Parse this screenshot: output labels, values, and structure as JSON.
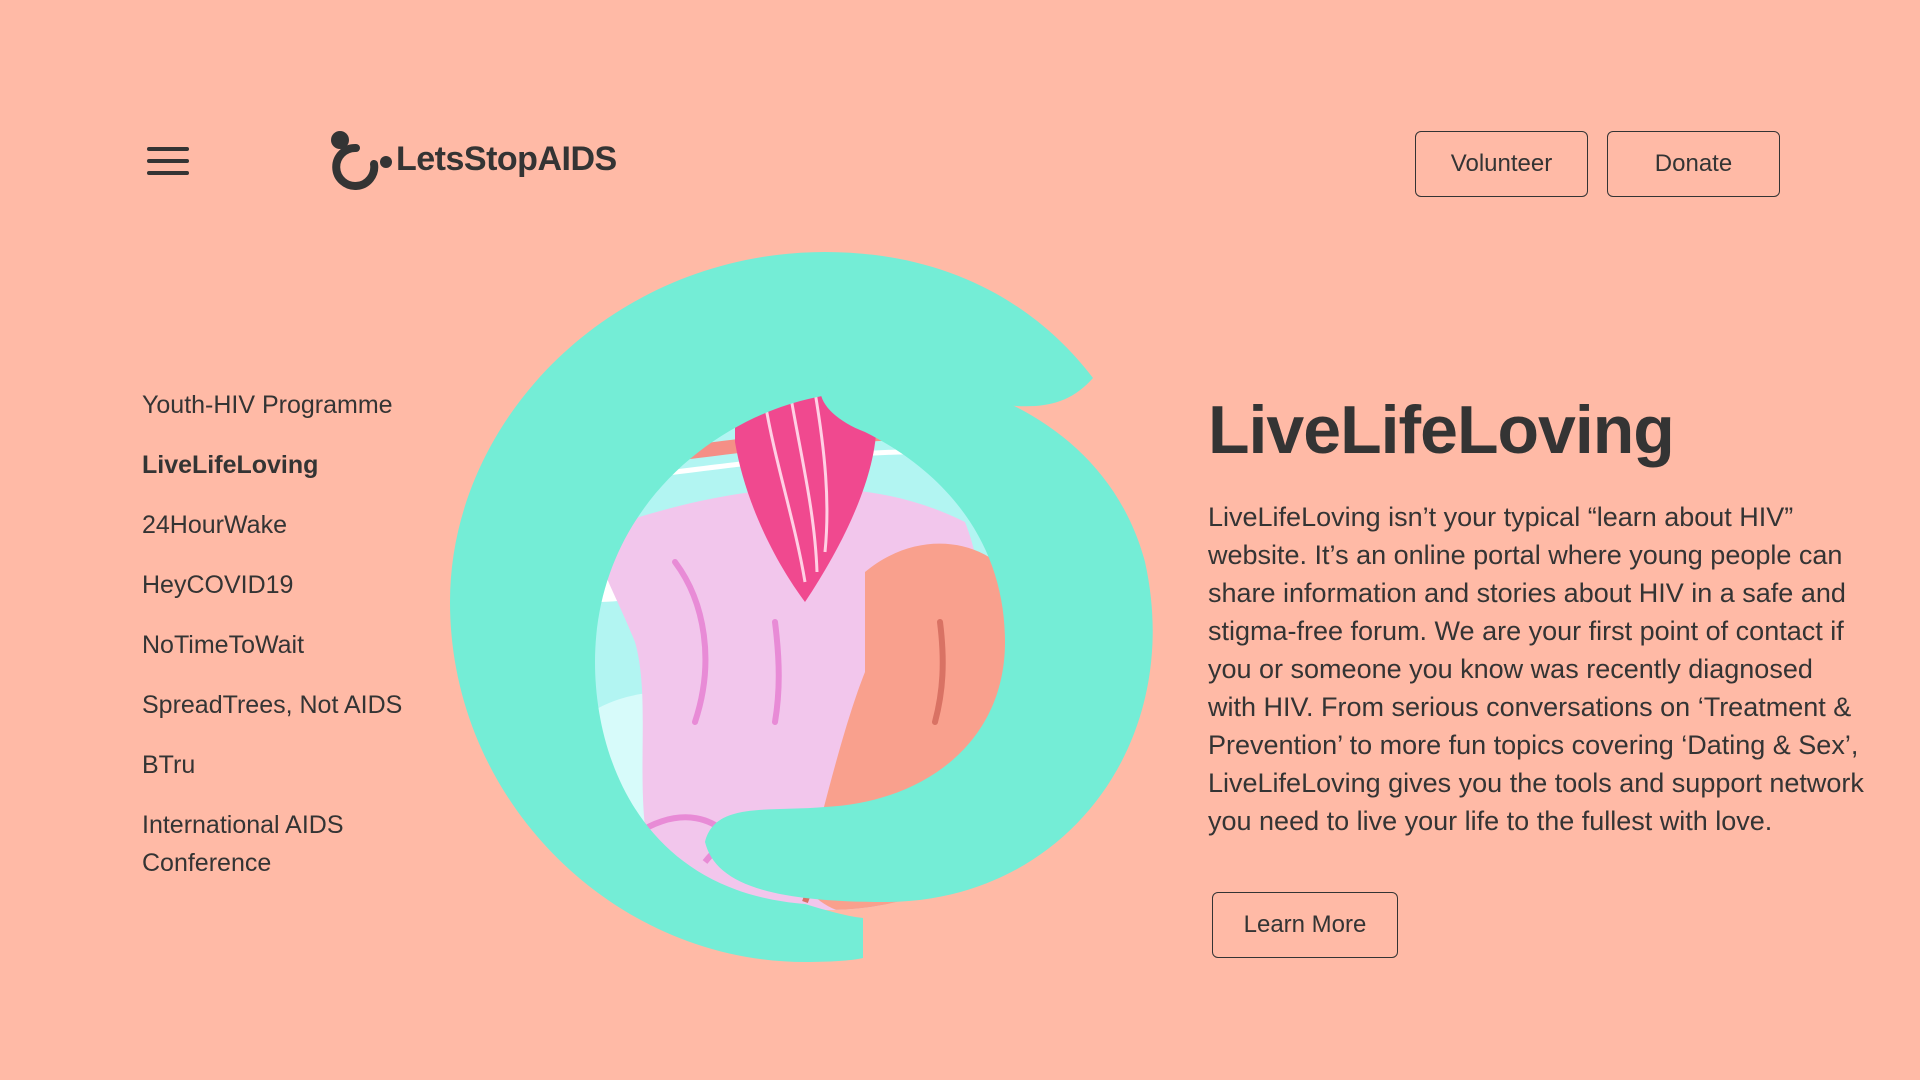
{
  "header": {
    "menu_icon": "hamburger-menu-icon",
    "logo_text": "LetsStopAIDS",
    "volunteer_label": "Volunteer",
    "donate_label": "Donate"
  },
  "side_nav": {
    "items": [
      {
        "label": "Youth-HIV Programme",
        "active": false
      },
      {
        "label": "LiveLifeLoving",
        "active": true
      },
      {
        "label": "24HourWake",
        "active": false
      },
      {
        "label": "HeyCOVID19",
        "active": false
      },
      {
        "label": "NoTimeToWait",
        "active": false
      },
      {
        "label": "SpreadTrees, Not AIDS",
        "active": false
      },
      {
        "label": "BTru",
        "active": false
      },
      {
        "label": "International AIDS Conference",
        "active": false
      }
    ]
  },
  "main": {
    "title": "LiveLifeLoving",
    "description": "LiveLifeLoving isn’t your typical “learn about HIV” website. It’s an online portal where young people can share information and stories about HIV in a safe and stigma-free forum. We are your first point of contact if you or someone you know was recently diagnosed with HIV. From serious conversations on ‘Treatment & Prevention’ to more fun topics covering ‘Dating & Sex’, LiveLifeLoving gives you the tools and support network you need to live your life to the fullest with love.",
    "learn_more_label": "Learn More"
  },
  "colors": {
    "background": "#ffbaa6",
    "text": "#343434",
    "accent_mint": "#74edd6",
    "illustration_pink": "#f2c6ec",
    "illustration_magenta": "#f0498f",
    "illustration_salmon": "#f9a08d"
  }
}
